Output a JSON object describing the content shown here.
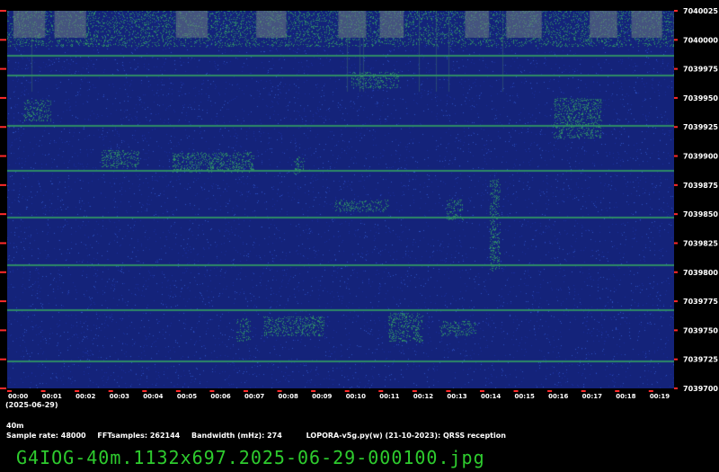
{
  "colors": {
    "background": "#000000",
    "waterfall_base": "#14237a",
    "noise": "#2d52c4",
    "signal": "#2e8a66",
    "tick_red": "#ff2a2a",
    "caption_green": "#2ecc2e"
  },
  "chart_data": {
    "type": "heatmap",
    "title": "",
    "xlabel": "",
    "ylabel": "",
    "x_tick_labels": [
      "00:00",
      "00:01",
      "00:02",
      "00:03",
      "00:04",
      "00:05",
      "00:06",
      "00:07",
      "00:08",
      "00:09",
      "00:10",
      "00:11",
      "00:12",
      "00:13",
      "00:14",
      "00:15",
      "00:16",
      "00:17",
      "00:18",
      "00:19"
    ],
    "y_tick_labels": [
      "7040025",
      "7040000",
      "7039975",
      "7039950",
      "7039925",
      "7039900",
      "7039875",
      "7039850",
      "7039825",
      "7039800",
      "7039775",
      "7039750",
      "7039725",
      "7039700"
    ],
    "y_range": [
      7039700,
      7040025
    ],
    "x_range_minutes": [
      0,
      19.75
    ],
    "horizontal_carrier_lines_hz": [
      7039987,
      7039970,
      7039927,
      7039888,
      7039848,
      7039807,
      7039768,
      7039724
    ],
    "signal_patches": [
      {
        "t0": 0.0,
        "t1": 19.75,
        "f0": 7039994,
        "f1": 7040025,
        "strength": 0.55
      },
      {
        "t0": 0.5,
        "t1": 1.3,
        "f0": 7039930,
        "f1": 7039948,
        "strength": 0.5
      },
      {
        "t0": 2.8,
        "t1": 3.9,
        "f0": 7039890,
        "f1": 7039905,
        "strength": 0.55
      },
      {
        "t0": 4.9,
        "t1": 7.3,
        "f0": 7039886,
        "f1": 7039903,
        "strength": 0.55
      },
      {
        "t0": 8.5,
        "t1": 8.8,
        "f0": 7039884,
        "f1": 7039900,
        "strength": 0.5
      },
      {
        "t0": 10.2,
        "t1": 11.6,
        "f0": 7039958,
        "f1": 7039972,
        "strength": 0.5
      },
      {
        "t0": 9.7,
        "t1": 11.3,
        "f0": 7039852,
        "f1": 7039862,
        "strength": 0.45
      },
      {
        "t0": 13.0,
        "t1": 13.5,
        "f0": 7039845,
        "f1": 7039862,
        "strength": 0.5
      },
      {
        "t0": 14.3,
        "t1": 14.6,
        "f0": 7039800,
        "f1": 7039880,
        "strength": 0.5
      },
      {
        "t0": 16.2,
        "t1": 17.6,
        "f0": 7039915,
        "f1": 7039950,
        "strength": 0.5
      },
      {
        "t0": 6.8,
        "t1": 7.2,
        "f0": 7039740,
        "f1": 7039760,
        "strength": 0.45
      },
      {
        "t0": 7.6,
        "t1": 9.4,
        "f0": 7039745,
        "f1": 7039762,
        "strength": 0.5
      },
      {
        "t0": 11.3,
        "t1": 12.3,
        "f0": 7039740,
        "f1": 7039765,
        "strength": 0.55
      },
      {
        "t0": 12.8,
        "t1": 13.9,
        "f0": 7039745,
        "f1": 7039758,
        "strength": 0.45
      }
    ]
  },
  "date_label": "(2025-06-29)",
  "band_label": "40m",
  "info": {
    "sample_rate": "Sample rate: 48000",
    "fft_samples": "FFTsamples: 262144",
    "bandwidth": "Bandwidth (mHz): 274",
    "software": "LOPORA-v5g.py(w) (21-10-2023): QRSS reception"
  },
  "filename_caption": "G4IOG-40m.1132x697.2025-06-29-000100.jpg"
}
